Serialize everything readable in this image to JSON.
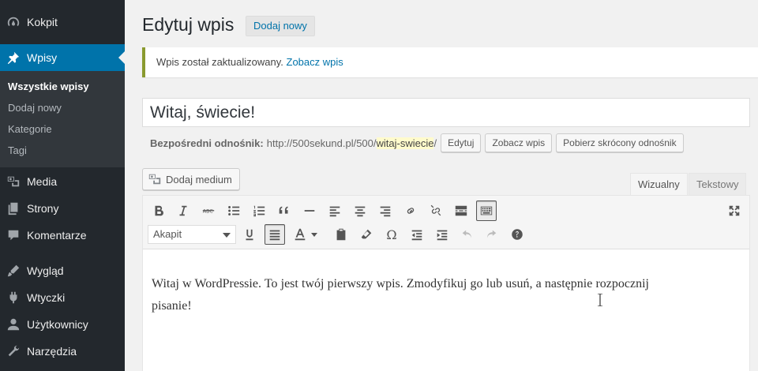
{
  "sidebar": {
    "items": [
      {
        "label": "Kokpit",
        "icon": "dashboard-icon"
      },
      {
        "label": "Wpisy",
        "icon": "pin-icon",
        "active": true
      },
      {
        "label": "Media",
        "icon": "media-icon"
      },
      {
        "label": "Strony",
        "icon": "pages-icon"
      },
      {
        "label": "Komentarze",
        "icon": "comments-icon"
      },
      {
        "label": "Wygląd",
        "icon": "appearance-icon"
      },
      {
        "label": "Wtyczki",
        "icon": "plugins-icon"
      },
      {
        "label": "Użytkownicy",
        "icon": "users-icon"
      },
      {
        "label": "Narzędzia",
        "icon": "tools-icon"
      }
    ],
    "submenu": [
      "Wszystkie wpisy",
      "Dodaj nowy",
      "Kategorie",
      "Tagi"
    ]
  },
  "header": {
    "title": "Edytuj wpis",
    "add_new": "Dodaj nowy"
  },
  "notice": {
    "text": "Wpis został zaktualizowany. ",
    "link": "Zobacz wpis"
  },
  "post": {
    "title": "Witaj, świecie!",
    "permalink_label": "Bezpośredni odnośnik:",
    "permalink_base": "http://500sekund.pl/500/",
    "permalink_slug": "witaj-swiecie",
    "permalink_end": "/",
    "btn_edit": "Edytuj",
    "btn_view": "Zobacz wpis",
    "btn_shortlink": "Pobierz skrócony odnośnik"
  },
  "editor": {
    "add_media": "Dodaj medium",
    "tab_visual": "Wizualny",
    "tab_text": "Tekstowy",
    "format": "Akapit",
    "content": "Witaj w WordPressie. To jest twój pierwszy wpis. Zmodyfikuj go lub usuń, a następnie rozpocznij pisanie!"
  },
  "colors": {
    "sidebar_bg": "#23282d",
    "active": "#0073aa",
    "link": "#0073aa"
  }
}
